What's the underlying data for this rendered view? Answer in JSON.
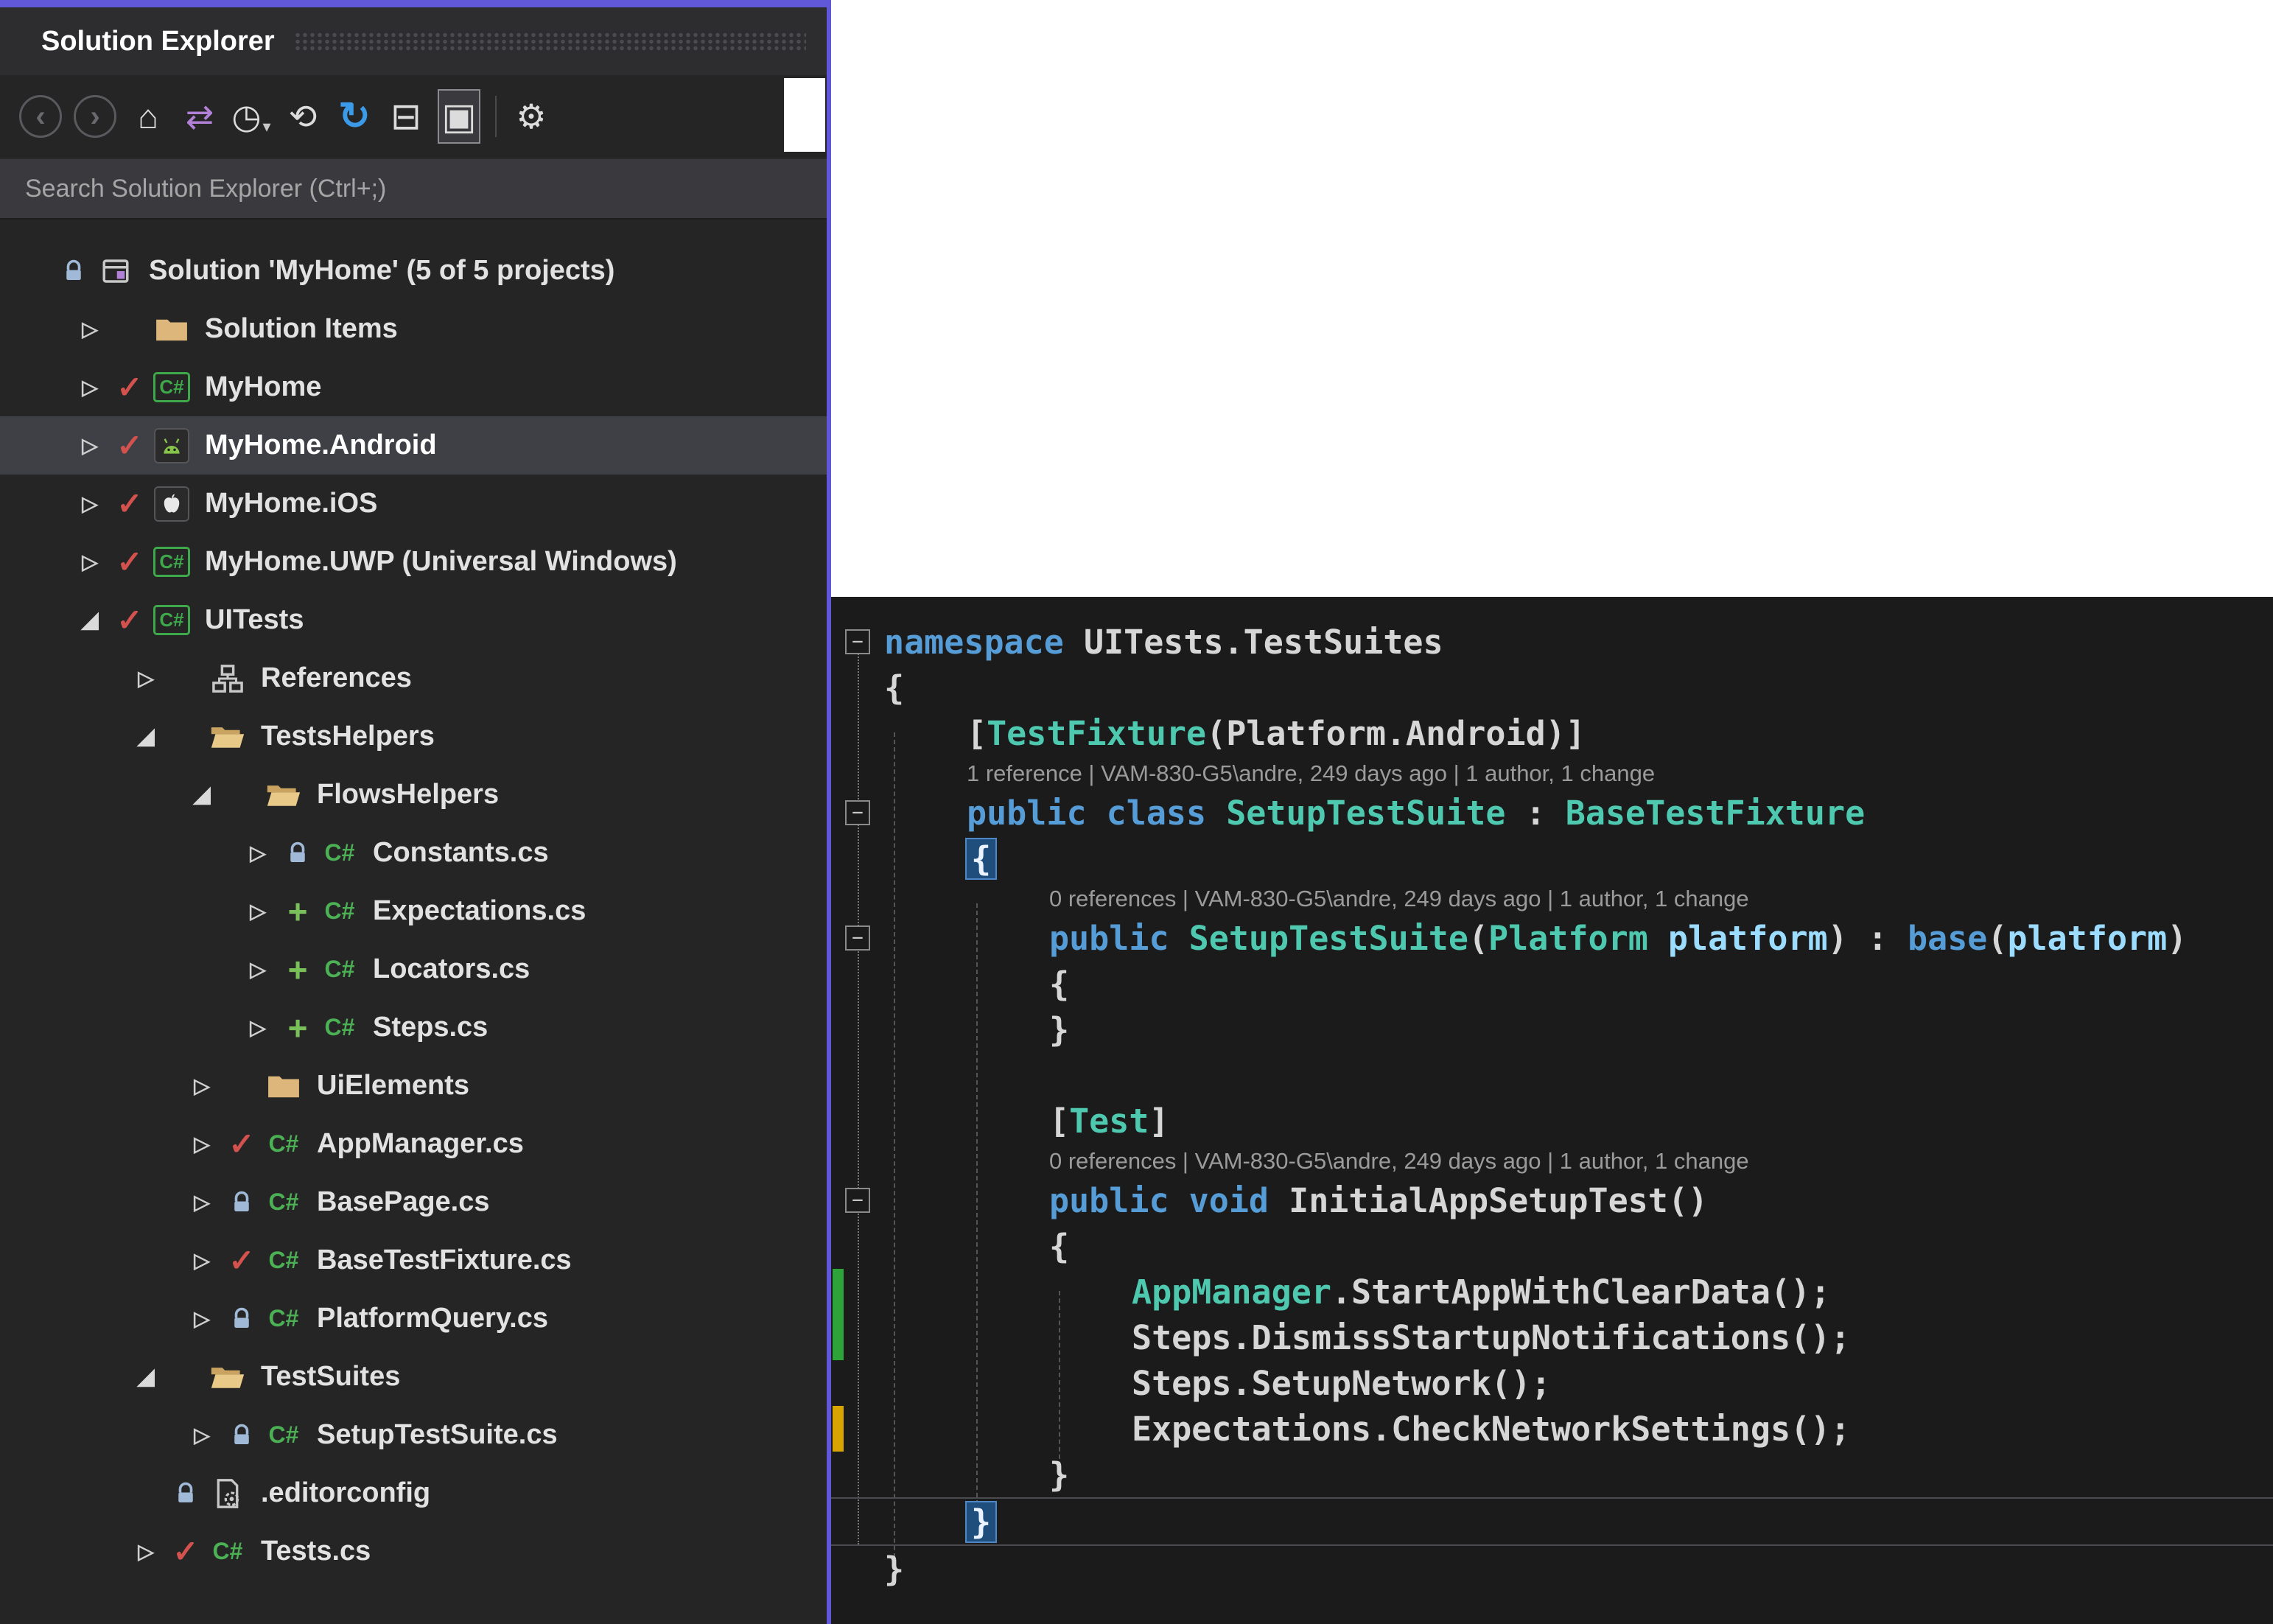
{
  "colors": {
    "accent": "#6158D9",
    "keyword": "#569CD6",
    "type": "#4EC9B0",
    "plain": "#D6D6D6",
    "parameter": "#9CDCFE",
    "codelens": "#9B9B9B",
    "brace_highlight": "#1F4E7C",
    "check": "#D4524E",
    "plus": "#79C05A",
    "folder": "#DCB67A",
    "csharp_green": "#3EA94B",
    "change_bar_saved": "#2EA33A",
    "change_bar_unsaved": "#D8A500",
    "selected_row": "#3F3F46"
  },
  "solution_explorer": {
    "title": "Solution Explorer",
    "search_placeholder": "Search Solution Explorer (Ctrl+;)",
    "toolbar": [
      {
        "name": "navigate-back",
        "glyph": "‹",
        "cls": "circle"
      },
      {
        "name": "navigate-forward",
        "glyph": "›",
        "cls": "circle"
      },
      {
        "name": "home",
        "glyph": "⌂",
        "cls": ""
      },
      {
        "name": "sync-with-active-document",
        "glyph": "⇄",
        "cls": "purple"
      },
      {
        "name": "pending-changes-filter",
        "glyph": "◷",
        "cls": "",
        "caret": true
      },
      {
        "name": "refresh",
        "glyph": "⟲",
        "cls": ""
      },
      {
        "name": "sync",
        "glyph": "↻",
        "cls": "blue"
      },
      {
        "name": "collapse-all",
        "glyph": "⊟",
        "cls": "boxed"
      },
      {
        "name": "show-all-files",
        "glyph": "▣",
        "cls": "boxed active"
      },
      {
        "name": "separator",
        "glyph": "",
        "cls": "sep"
      },
      {
        "name": "properties",
        "glyph": "⚙",
        "cls": ""
      }
    ],
    "tree": [
      {
        "label": "Solution 'MyHome' (5 of 5 projects)",
        "indent": 0,
        "expander": "none",
        "status": "lock",
        "icon": "solution"
      },
      {
        "label": "Solution Items",
        "indent": 1,
        "expander": "collapsed",
        "status": "none",
        "icon": "folder"
      },
      {
        "label": "MyHome",
        "indent": 1,
        "expander": "collapsed",
        "status": "check",
        "icon": "csproj"
      },
      {
        "label": "MyHome.Android",
        "indent": 1,
        "expander": "collapsed",
        "status": "check",
        "icon": "android",
        "selected": true
      },
      {
        "label": "MyHome.iOS",
        "indent": 1,
        "expander": "collapsed",
        "status": "check",
        "icon": "apple"
      },
      {
        "label": "MyHome.UWP (Universal Windows)",
        "indent": 1,
        "expander": "collapsed",
        "status": "check",
        "icon": "csproj"
      },
      {
        "label": "UITests",
        "indent": 1,
        "expander": "expanded",
        "status": "check",
        "icon": "csproj"
      },
      {
        "label": "References",
        "indent": 2,
        "expander": "collapsed",
        "status": "none",
        "icon": "references"
      },
      {
        "label": "TestsHelpers",
        "indent": 2,
        "expander": "expanded",
        "status": "none",
        "icon": "folder-open"
      },
      {
        "label": "FlowsHelpers",
        "indent": 3,
        "expander": "expanded",
        "status": "none",
        "icon": "folder-open"
      },
      {
        "label": "Constants.cs",
        "indent": 4,
        "expander": "collapsed",
        "status": "lock",
        "icon": "csfile"
      },
      {
        "label": "Expectations.cs",
        "indent": 4,
        "expander": "collapsed",
        "status": "plus",
        "icon": "csfile"
      },
      {
        "label": "Locators.cs",
        "indent": 4,
        "expander": "collapsed",
        "status": "plus",
        "icon": "csfile"
      },
      {
        "label": "Steps.cs",
        "indent": 4,
        "expander": "collapsed",
        "status": "plus",
        "icon": "csfile"
      },
      {
        "label": "UiElements",
        "indent": 3,
        "expander": "collapsed",
        "status": "none",
        "icon": "folder"
      },
      {
        "label": "AppManager.cs",
        "indent": 3,
        "expander": "collapsed",
        "status": "check",
        "icon": "csfile"
      },
      {
        "label": "BasePage.cs",
        "indent": 3,
        "expander": "collapsed",
        "status": "lock",
        "icon": "csfile"
      },
      {
        "label": "BaseTestFixture.cs",
        "indent": 3,
        "expander": "collapsed",
        "status": "check",
        "icon": "csfile"
      },
      {
        "label": "PlatformQuery.cs",
        "indent": 3,
        "expander": "collapsed",
        "status": "lock",
        "icon": "csfile"
      },
      {
        "label": "TestSuites",
        "indent": 2,
        "expander": "expanded",
        "status": "none",
        "icon": "folder-open"
      },
      {
        "label": "SetupTestSuite.cs",
        "indent": 3,
        "expander": "collapsed",
        "status": "lock",
        "icon": "csfile"
      },
      {
        "label": ".editorconfig",
        "indent": 2,
        "expander": "none",
        "status": "lock",
        "icon": "editorconfig"
      },
      {
        "label": "Tests.cs",
        "indent": 2,
        "expander": "collapsed",
        "status": "check",
        "icon": "csfile"
      }
    ]
  },
  "editor": {
    "lines": [
      {
        "type": "code",
        "indent": 0,
        "outline": true,
        "tokens": [
          [
            "kw",
            "namespace "
          ],
          [
            "pl",
            "UITests.TestSuites"
          ]
        ]
      },
      {
        "type": "code",
        "indent": 0,
        "tokens": [
          [
            "pl",
            "{"
          ]
        ]
      },
      {
        "type": "code",
        "indent": 1,
        "tokens": [
          [
            "pl",
            "["
          ],
          [
            "ty",
            "TestFixture"
          ],
          [
            "pl",
            "(Platform.Android)]"
          ]
        ]
      },
      {
        "type": "lens",
        "indent": 1,
        "text": "1 reference | VAM-830-G5\\andre, 249 days ago | 1 author, 1 change"
      },
      {
        "type": "code",
        "indent": 1,
        "outline": true,
        "tokens": [
          [
            "kw",
            "public class "
          ],
          [
            "ty",
            "SetupTestSuite"
          ],
          [
            "pl",
            " : "
          ],
          [
            "ty",
            "BaseTestFixture"
          ]
        ]
      },
      {
        "type": "code",
        "indent": 1,
        "tokens": [
          [
            "hl",
            "{"
          ]
        ]
      },
      {
        "type": "lens",
        "indent": 2,
        "text": "0 references | VAM-830-G5\\andre, 249 days ago | 1 author, 1 change"
      },
      {
        "type": "code",
        "indent": 2,
        "outline": true,
        "tokens": [
          [
            "kw",
            "public "
          ],
          [
            "ty",
            "SetupTestSuite"
          ],
          [
            "pl",
            "("
          ],
          [
            "ty",
            "Platform"
          ],
          [
            "pl",
            " "
          ],
          [
            "pa",
            "platform"
          ],
          [
            "pl",
            ") : "
          ],
          [
            "kw",
            "base"
          ],
          [
            "pl",
            "("
          ],
          [
            "pa",
            "platform"
          ],
          [
            "pl",
            ")"
          ]
        ]
      },
      {
        "type": "code",
        "indent": 2,
        "tokens": [
          [
            "pl",
            "{"
          ]
        ]
      },
      {
        "type": "code",
        "indent": 2,
        "tokens": [
          [
            "pl",
            "}"
          ]
        ]
      },
      {
        "type": "blank"
      },
      {
        "type": "code",
        "indent": 2,
        "tokens": [
          [
            "pl",
            "["
          ],
          [
            "ty",
            "Test"
          ],
          [
            "pl",
            "]"
          ]
        ]
      },
      {
        "type": "lens",
        "indent": 2,
        "text": "0 references | VAM-830-G5\\andre, 249 days ago | 1 author, 1 change"
      },
      {
        "type": "code",
        "indent": 2,
        "outline": true,
        "tokens": [
          [
            "kw",
            "public void "
          ],
          [
            "pl",
            "InitialAppSetupTest()"
          ]
        ]
      },
      {
        "type": "code",
        "indent": 2,
        "tokens": [
          [
            "pl",
            "{"
          ]
        ]
      },
      {
        "type": "code",
        "indent": 3,
        "bar": "green",
        "tokens": [
          [
            "ty",
            "AppManager"
          ],
          [
            "pl",
            ".StartAppWithClearData();"
          ]
        ]
      },
      {
        "type": "code",
        "indent": 3,
        "bar": "green",
        "tokens": [
          [
            "pl",
            "Steps.DismissStartupNotifications();"
          ]
        ]
      },
      {
        "type": "code",
        "indent": 3,
        "tokens": [
          [
            "pl",
            "Steps.SetupNetwork();"
          ]
        ]
      },
      {
        "type": "code",
        "indent": 3,
        "bar": "yellow",
        "tokens": [
          [
            "pl",
            "Expectations.CheckNetworkSettings();"
          ]
        ]
      },
      {
        "type": "code",
        "indent": 2,
        "tokens": [
          [
            "pl",
            "}"
          ]
        ]
      },
      {
        "type": "code",
        "indent": 1,
        "current": true,
        "tokens": [
          [
            "hl",
            "}"
          ]
        ]
      },
      {
        "type": "code",
        "indent": 0,
        "tokens": [
          [
            "pl",
            "}"
          ]
        ]
      }
    ]
  }
}
